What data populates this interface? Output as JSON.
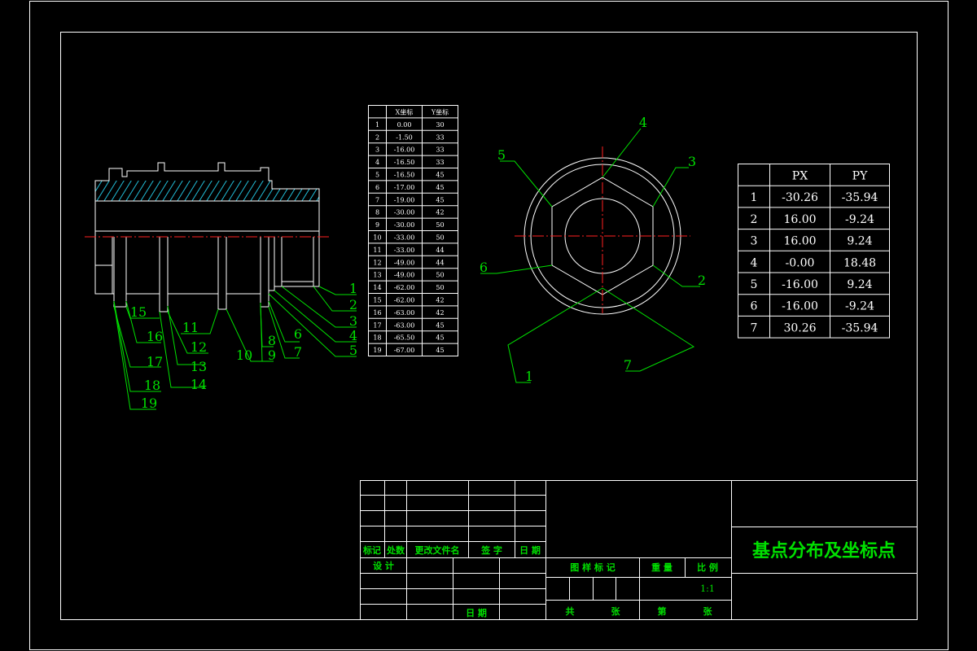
{
  "small_table": {
    "headers": [
      "X坐标",
      "Y坐标"
    ],
    "rows": [
      [
        "1",
        "0.00",
        "30"
      ],
      [
        "2",
        "-1.50",
        "33"
      ],
      [
        "3",
        "-16.00",
        "33"
      ],
      [
        "4",
        "-16.50",
        "33"
      ],
      [
        "5",
        "-16.50",
        "45"
      ],
      [
        "6",
        "-17.00",
        "45"
      ],
      [
        "7",
        "-19.00",
        "45"
      ],
      [
        "8",
        "-30.00",
        "42"
      ],
      [
        "9",
        "-30.00",
        "50"
      ],
      [
        "10",
        "-33.00",
        "50"
      ],
      [
        "11",
        "-33.00",
        "44"
      ],
      [
        "12",
        "-49.00",
        "44"
      ],
      [
        "13",
        "-49.00",
        "50"
      ],
      [
        "14",
        "-62.00",
        "50"
      ],
      [
        "15",
        "-62.00",
        "42"
      ],
      [
        "16",
        "-63.00",
        "42"
      ],
      [
        "17",
        "-63.00",
        "45"
      ],
      [
        "18",
        "-65.50",
        "45"
      ],
      [
        "19",
        "-67.00",
        "45"
      ]
    ]
  },
  "px_table": {
    "headers": [
      "PX",
      "PY"
    ],
    "rows": [
      [
        "1",
        "-30.26",
        "-35.94"
      ],
      [
        "2",
        "16.00",
        "-9.24"
      ],
      [
        "3",
        "16.00",
        "9.24"
      ],
      [
        "4",
        "-0.00",
        "18.48"
      ],
      [
        "5",
        "-16.00",
        "9.24"
      ],
      [
        "6",
        "-16.00",
        "-9.24"
      ],
      [
        "7",
        "30.26",
        "-35.94"
      ]
    ]
  },
  "section_labels": [
    "1",
    "2",
    "3",
    "4",
    "5",
    "6",
    "7",
    "8",
    "9",
    "10",
    "11",
    "12",
    "13",
    "14",
    "15",
    "16",
    "17",
    "18",
    "19"
  ],
  "hex_labels": [
    "1",
    "2",
    "3",
    "4",
    "5",
    "6",
    "7"
  ],
  "title_block": {
    "header_row": [
      "标记",
      "处数",
      "更改文件名",
      "签  字",
      "日  期"
    ],
    "design": "设  计",
    "date": "日  期",
    "drawing_mark": "图 样 标 记",
    "weight": "重 量",
    "scale_label": "比 例",
    "scale_value": "1:1",
    "total": "共",
    "sheets1": "张",
    "sheet_no": "第",
    "sheets2": "张",
    "title": "基点分布及坐标点"
  },
  "colors": {
    "line": "#ffffff",
    "annotation": "#00e000",
    "centerline": "#ff2020",
    "hatch": "#22bcd6"
  }
}
